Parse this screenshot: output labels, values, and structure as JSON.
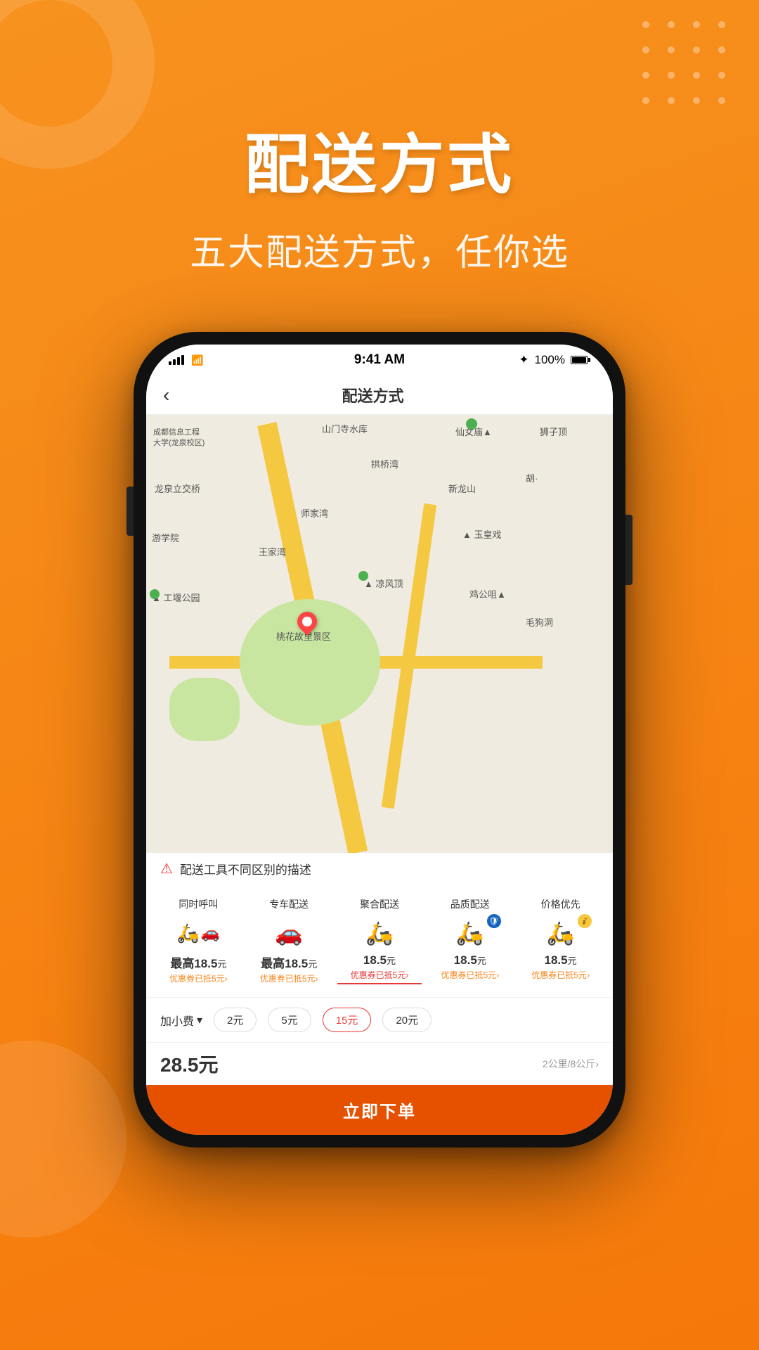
{
  "background_color": "#F7851A",
  "header": {
    "main_title": "配送方式",
    "sub_title": "五大配送方式，任你选"
  },
  "phone": {
    "status_bar": {
      "time": "9:41 AM",
      "battery": "100%",
      "signal": "full"
    },
    "nav": {
      "title": "配送方式",
      "back": "‹"
    },
    "map": {
      "warning_text": "配送工具不同区别的描述"
    },
    "delivery_options": [
      {
        "title": "同时呼叫",
        "price": "最高18.5元",
        "coupon": "优惠券已抵5元›",
        "icon_type": "moto+car",
        "selected": false
      },
      {
        "title": "专车配送",
        "price": "最高18.5元",
        "coupon": "优惠券已抵5元›",
        "icon_type": "car",
        "selected": false
      },
      {
        "title": "聚合配送",
        "price": "18.5元",
        "coupon": "优惠券已抵5元›",
        "icon_type": "moto",
        "selected": true
      },
      {
        "title": "品质配送",
        "price": "18.5元",
        "coupon": "优惠券已抵5元›",
        "icon_type": "moto+shield",
        "selected": false
      },
      {
        "title": "价格优先",
        "price": "18.5元",
        "coupon": "优惠券已抵5元›",
        "icon_type": "moto+bag",
        "selected": false
      }
    ],
    "extra_fee": {
      "label": "加小费",
      "options": [
        "2元",
        "5元",
        "15元",
        "20元"
      ],
      "selected": "15元"
    },
    "total": {
      "price": "28.5元",
      "info": "2公里/8公斤›"
    },
    "order_button": "立即下单"
  },
  "decorative": {
    "dots_color": "rgba(255,255,255,0.35)"
  }
}
